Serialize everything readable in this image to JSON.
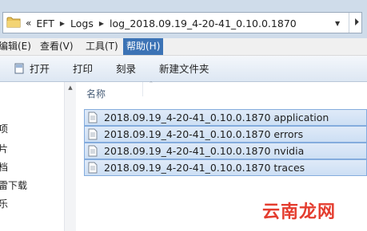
{
  "address": {
    "overflow_chevron": "«",
    "crumbs": [
      "EFT",
      "Logs",
      "log_2018.09.19_4-20-41_0.10.0.1870"
    ],
    "separator": "▶",
    "dropdown": "▼",
    "end_button": "⏵"
  },
  "menu": [
    {
      "label": "编辑(E)"
    },
    {
      "label": "查看(V)"
    },
    {
      "label": "工具(T)"
    },
    {
      "label": "帮助(H)",
      "active": true
    }
  ],
  "toolbar": {
    "open": "打开",
    "print": "打印",
    "burn": "刻录",
    "new_folder": "新建文件夹"
  },
  "nav": [
    "项",
    "片",
    "档",
    "雷下载",
    "乐"
  ],
  "list": {
    "column_name": "名称",
    "files": [
      "2018.09.19_4-20-41_0.10.0.1870 application",
      "2018.09.19_4-20-41_0.10.0.1870 errors",
      "2018.09.19_4-20-41_0.10.0.1870 nvidia",
      "2018.09.19_4-20-41_0.10.0.1870 traces"
    ]
  },
  "watermark": "云南龙网",
  "colors": {
    "selection_bg": "#d5e4f6",
    "selection_border": "#84acdd",
    "menu_active": "#3c73b5",
    "watermark": "#e43d2f"
  }
}
